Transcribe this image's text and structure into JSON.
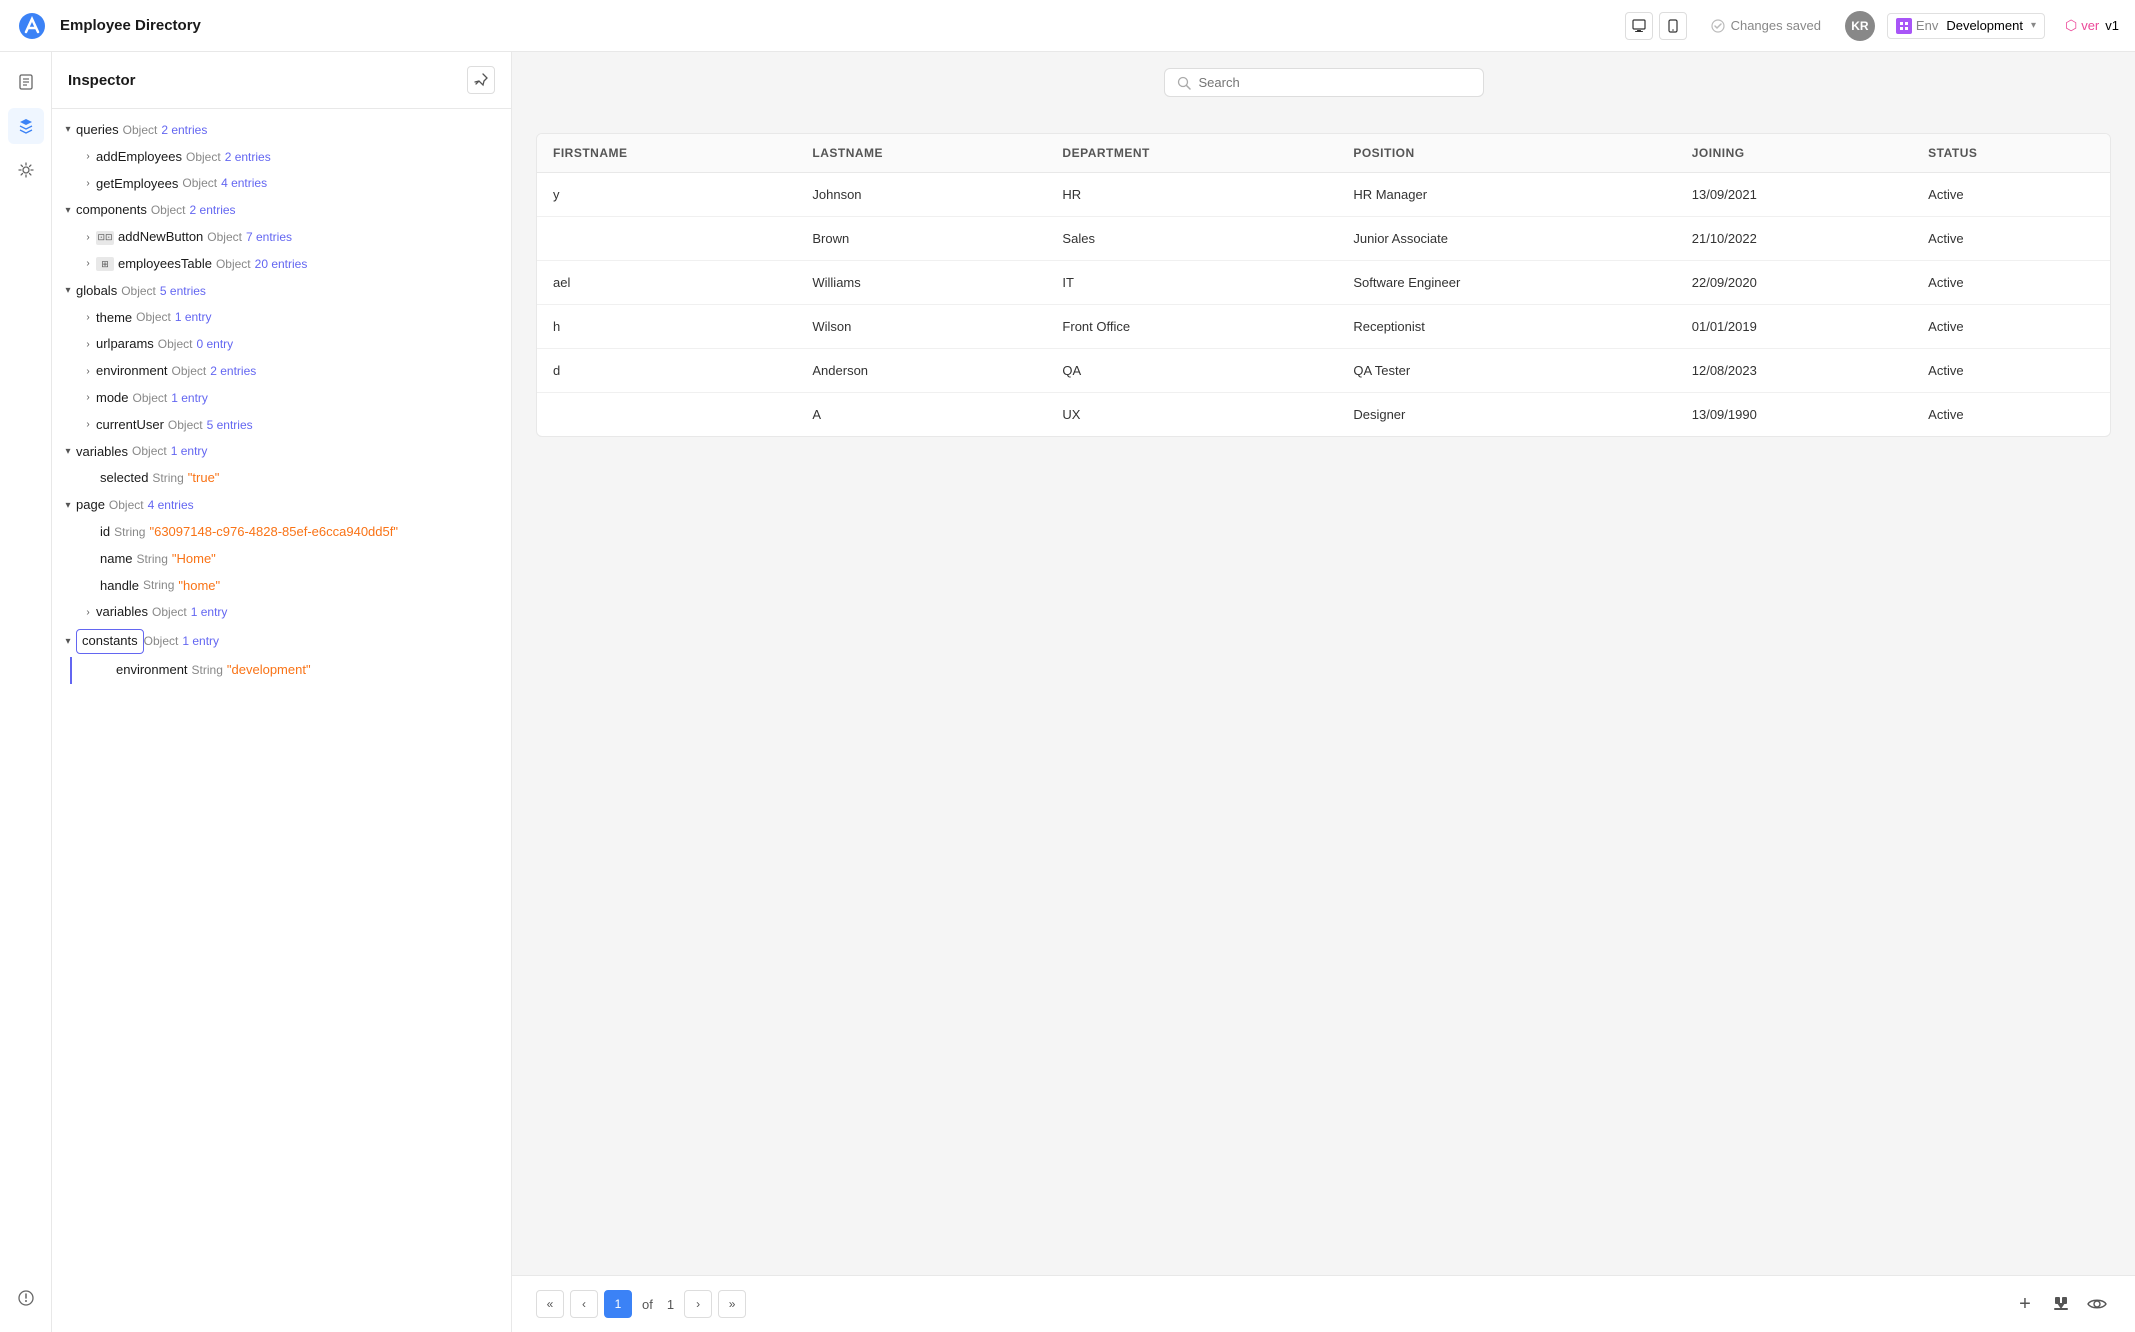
{
  "topbar": {
    "title": "Employee Directory",
    "status": "Changes saved",
    "avatar": "KR",
    "env_label": "Env",
    "env_value": "Development",
    "ver_label": "ver",
    "ver_value": "v1",
    "icon1": "■",
    "icon2": "▣"
  },
  "inspector": {
    "title": "Inspector",
    "tree": [
      {
        "indent": 0,
        "toggle": "▾",
        "key": "queries",
        "type": "Object",
        "meta": "2 entries"
      },
      {
        "indent": 1,
        "toggle": "›",
        "key": "addEmployees",
        "type": "Object",
        "meta": "2 entries"
      },
      {
        "indent": 1,
        "toggle": "›",
        "key": "getEmployees",
        "type": "Object",
        "meta": "4 entries"
      },
      {
        "indent": 0,
        "toggle": "▾",
        "key": "components",
        "type": "Object",
        "meta": "2 entries"
      },
      {
        "indent": 1,
        "toggle": "›",
        "key": "addNewButton",
        "type": "Object",
        "meta": "7 entries",
        "icon": "btn"
      },
      {
        "indent": 1,
        "toggle": "›",
        "key": "employeesTable",
        "type": "Object",
        "meta": "20 entries",
        "icon": "tbl"
      },
      {
        "indent": 0,
        "toggle": "▾",
        "key": "globals",
        "type": "Object",
        "meta": "5 entries"
      },
      {
        "indent": 1,
        "toggle": "›",
        "key": "theme",
        "type": "Object",
        "meta": "1 entry"
      },
      {
        "indent": 1,
        "toggle": "›",
        "key": "urlparams",
        "type": "Object",
        "meta": "0 entry"
      },
      {
        "indent": 1,
        "toggle": "›",
        "key": "environment",
        "type": "Object",
        "meta": "2 entries"
      },
      {
        "indent": 1,
        "toggle": "›",
        "key": "mode",
        "type": "Object",
        "meta": "1 entry"
      },
      {
        "indent": 1,
        "toggle": "›",
        "key": "currentUser",
        "type": "Object",
        "meta": "5 entries"
      },
      {
        "indent": 0,
        "toggle": "▾",
        "key": "variables",
        "type": "Object",
        "meta": "1 entry"
      },
      {
        "indent": 1,
        "toggle": "",
        "key": "selected",
        "type": "String",
        "value": "\"true\""
      },
      {
        "indent": 0,
        "toggle": "▾",
        "key": "page",
        "type": "Object",
        "meta": "4 entries"
      },
      {
        "indent": 1,
        "toggle": "",
        "key": "id",
        "type": "String",
        "value": "\"63097148-c976-4828-85ef-e6cca940dd5f\""
      },
      {
        "indent": 1,
        "toggle": "",
        "key": "name",
        "type": "String",
        "value": "\"Home\""
      },
      {
        "indent": 1,
        "toggle": "",
        "key": "handle",
        "type": "String",
        "value": "\"home\""
      },
      {
        "indent": 1,
        "toggle": "›",
        "key": "variables",
        "type": "Object",
        "meta": "1 entry"
      },
      {
        "indent": 0,
        "toggle": "▾",
        "key": "constants",
        "type": "Object",
        "meta": "1 entry",
        "highlighted": true
      },
      {
        "indent": 1,
        "toggle": "",
        "key": "environment",
        "type": "String",
        "value": "\"development\"",
        "lined": true
      }
    ]
  },
  "table": {
    "search_placeholder": "Search",
    "columns": [
      "FIRSTNAME",
      "LASTNAME",
      "DEPARTMENT",
      "POSITION",
      "JOINING",
      "STATUS"
    ],
    "rows": [
      {
        "firstname": "y",
        "lastname": "Johnson",
        "department": "HR",
        "position": "HR Manager",
        "joining": "13/09/2021",
        "status": "Active"
      },
      {
        "firstname": "",
        "lastname": "Brown",
        "department": "Sales",
        "position": "Junior Associate",
        "joining": "21/10/2022",
        "status": "Active"
      },
      {
        "firstname": "ael",
        "lastname": "Williams",
        "department": "IT",
        "position": "Software Engineer",
        "joining": "22/09/2020",
        "status": "Active"
      },
      {
        "firstname": "h",
        "lastname": "Wilson",
        "department": "Front Office",
        "position": "Receptionist",
        "joining": "01/01/2019",
        "status": "Active"
      },
      {
        "firstname": "d",
        "lastname": "Anderson",
        "department": "QA",
        "position": "QA Tester",
        "joining": "12/08/2023",
        "status": "Active"
      },
      {
        "firstname": "",
        "lastname": "A",
        "department": "UX",
        "position": "Designer",
        "joining": "13/09/1990",
        "status": "Active"
      }
    ]
  },
  "pagination": {
    "first": "«",
    "prev": "‹",
    "current": "1",
    "of_label": "of",
    "total": "1",
    "next": "›",
    "last": "»",
    "add": "+",
    "download": "↓",
    "eye": "👁"
  },
  "sidebar_icons": [
    {
      "name": "document-icon",
      "symbol": "≡"
    },
    {
      "name": "cursor-icon",
      "symbol": "▶",
      "active": true
    },
    {
      "name": "gear-icon",
      "symbol": "⚙"
    },
    {
      "name": "settings-icon",
      "symbol": "⋮"
    }
  ]
}
